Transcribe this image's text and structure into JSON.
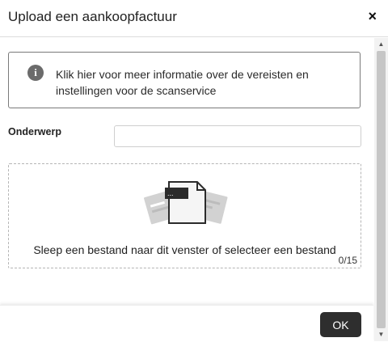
{
  "dialog": {
    "title": "Upload een aankoopfactuur",
    "close_icon": "×"
  },
  "info": {
    "icon": "i",
    "text": "Klik hier voor meer informatie over de vereisten en instellingen voor de scanservice"
  },
  "subject": {
    "label": "Onderwerp",
    "value": ""
  },
  "dropzone": {
    "text": "Sleep een bestand naar dit venster of selecteer een bestand",
    "counter": "0/15",
    "doc_label": "..."
  },
  "footer": {
    "ok_label": "OK"
  },
  "icons": {
    "scroll_up": "▲",
    "scroll_down": "▼"
  }
}
